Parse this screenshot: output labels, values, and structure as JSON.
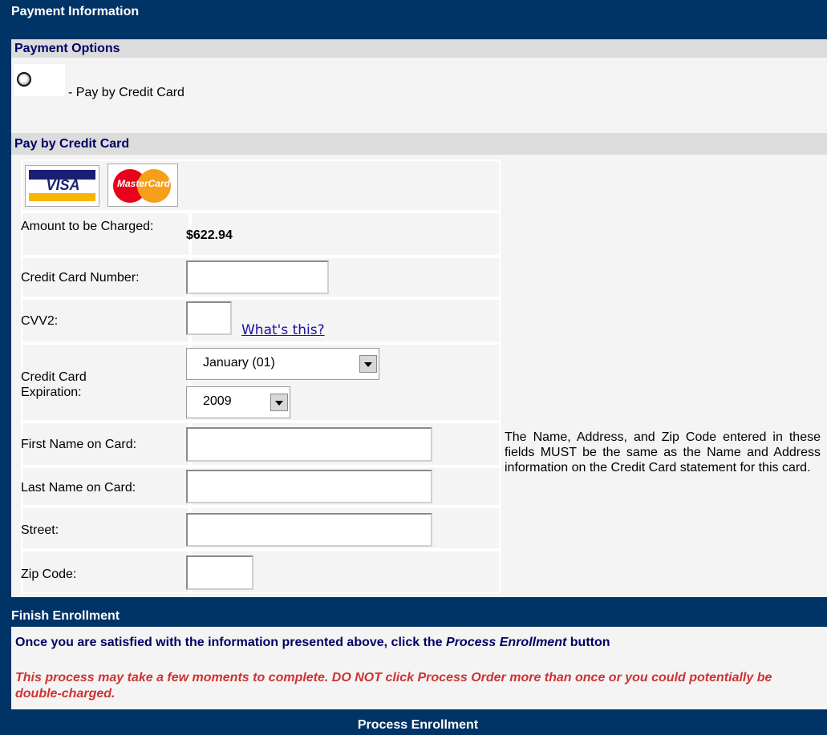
{
  "header": {
    "title": "Payment Information"
  },
  "payment_options": {
    "title": "Payment Options",
    "option_label": "-  Pay by Credit Card"
  },
  "credit_card": {
    "title": "Pay by Credit Card",
    "logos": {
      "visa": "VISA",
      "mastercard": "MasterCard"
    },
    "amount_label": "Amount to be Charged:",
    "amount_value": "$622.94",
    "number_label": "Credit Card Number:",
    "number_value": "",
    "cvv_label": "CVV2:",
    "cvv_value": "",
    "cvv_help": "What's this?",
    "expiration_label": "Credit Card Expiration:",
    "expiration_month": "January (01)",
    "expiration_year": "2009",
    "first_name_label": "First Name on Card:",
    "last_name_label": "Last Name on Card:",
    "street_label": "Street:",
    "zip_label": "Zip Code:",
    "note": "The Name, Address, and Zip Code entered in these fields MUST be the same as the Name and Address information on the Credit Card statement for this card."
  },
  "finish": {
    "title": "Finish Enrollment",
    "instruction_prefix": "Once you are satisfied with the information presented above, click the",
    "instruction_button_name": "Process Enrollment",
    "instruction_suffix": "button",
    "warning": "This process may take a few moments to complete. DO NOT click Process Order more than once or you could potentially be double-charged.",
    "button_label": "Process Enrollment"
  },
  "colors": {
    "navy": "#003366",
    "section_text": "#000066",
    "warning": "#cc3333",
    "panel": "#f4f4f4",
    "subheader": "#dcdcdc"
  }
}
